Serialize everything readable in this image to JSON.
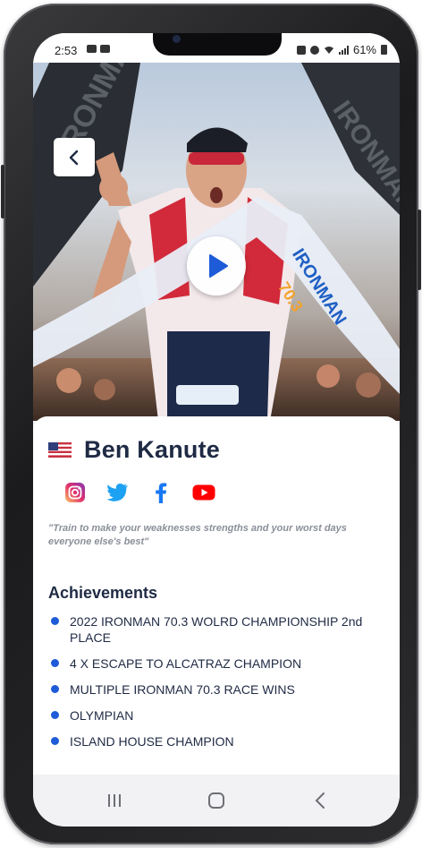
{
  "status": {
    "time": "2:53",
    "battery_percent": "61%"
  },
  "hero": {
    "back_icon": "chevron-left-icon",
    "play_icon": "play-icon"
  },
  "athlete": {
    "flag": "us-flag",
    "name": "Ben Kanute",
    "quote": "\"Train to make your weaknesses strengths and your worst days everyone else's best\""
  },
  "socials": [
    {
      "name": "instagram-icon",
      "color": "#e1306c"
    },
    {
      "name": "twitter-icon",
      "color": "#1da1f2"
    },
    {
      "name": "facebook-icon",
      "color": "#1877f2"
    },
    {
      "name": "youtube-icon",
      "color": "#ff0000"
    }
  ],
  "achievements": {
    "title": "Achievements",
    "items": [
      "2022 IRONMAN 70.3 WOLRD CHAMPIONSHIP 2nd PLACE",
      "4 X ESCAPE TO ALCATRAZ CHAMPION",
      "MULTIPLE IRONMAN 70.3 RACE WINS",
      "OLYMPIAN",
      "ISLAND HOUSE CHAMPION"
    ]
  },
  "nav": {
    "recents_icon": "recents-icon",
    "home_icon": "home-icon",
    "back_icon": "back-icon"
  },
  "colors": {
    "accent": "#1e5bd8",
    "heading": "#1f2a44",
    "muted": "#8a8f99"
  }
}
